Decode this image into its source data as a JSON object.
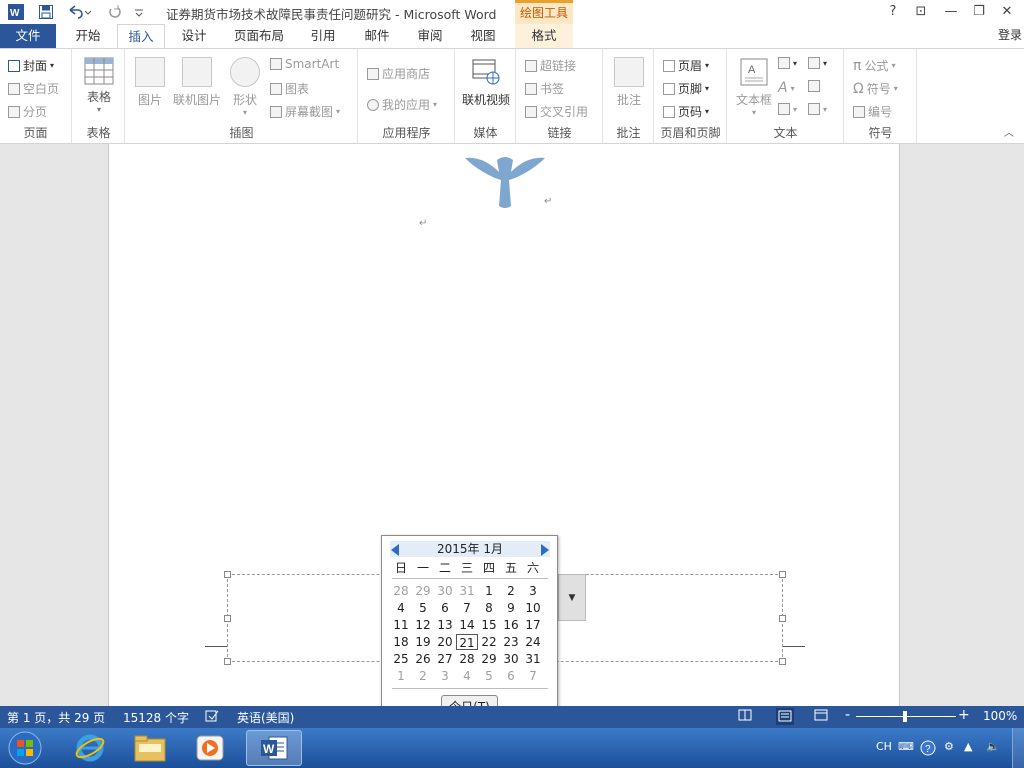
{
  "titlebar": {
    "title": "证券期货市场技术故障民事责任问题研究 - Microsoft Word",
    "context_tool": "绘图工具",
    "help": "?",
    "restore_ribbon": "⊡",
    "minimize": "—",
    "restore": "❐",
    "close": "✕"
  },
  "tabs": {
    "file": "文件",
    "home": "开始",
    "insert": "插入",
    "design": "设计",
    "layout": "页面布局",
    "references": "引用",
    "mailings": "邮件",
    "review": "审阅",
    "view": "视图",
    "format": "格式",
    "login": "登录"
  },
  "ribbon": {
    "pages": {
      "label": "页面",
      "cover": "封面",
      "blank": "空白页",
      "break": "分页"
    },
    "tables": {
      "label": "表格",
      "table": "表格"
    },
    "illustrations": {
      "label": "插图",
      "picture": "图片",
      "online_picture": "联机图片",
      "shapes": "形状",
      "smartart": "SmartArt",
      "chart": "图表",
      "screenshot": "屏幕截图"
    },
    "apps": {
      "label": "应用程序",
      "store": "应用商店",
      "my_apps": "我的应用"
    },
    "media": {
      "label": "媒体",
      "online_video": "联机视频"
    },
    "links": {
      "label": "链接",
      "hyperlink": "超链接",
      "bookmark": "书签",
      "cross_ref": "交叉引用"
    },
    "comments": {
      "label": "批注",
      "comment": "批注"
    },
    "header_footer": {
      "label": "页眉和页脚",
      "header": "页眉",
      "footer": "页脚",
      "page_number": "页码"
    },
    "text": {
      "label": "文本",
      "textbox": "文本框"
    },
    "symbols": {
      "label": "符号",
      "equation": "公式",
      "symbol": "符号",
      "number": "编号"
    }
  },
  "document": {
    "para_mark": "↵"
  },
  "calendar": {
    "month_label": "2015年 1月",
    "weekdays": [
      "日",
      "一",
      "二",
      "三",
      "四",
      "五",
      "六"
    ],
    "weeks": [
      [
        "28",
        "29",
        "30",
        "31",
        "1",
        "2",
        "3"
      ],
      [
        "4",
        "5",
        "6",
        "7",
        "8",
        "9",
        "10"
      ],
      [
        "11",
        "12",
        "13",
        "14",
        "15",
        "16",
        "17"
      ],
      [
        "18",
        "19",
        "20",
        "21",
        "22",
        "23",
        "24"
      ],
      [
        "25",
        "26",
        "27",
        "28",
        "29",
        "30",
        "31"
      ],
      [
        "1",
        "2",
        "3",
        "4",
        "5",
        "6",
        "7"
      ]
    ],
    "today_button": "今日(T)"
  },
  "statusbar": {
    "page": "第 1 页，共 29 页",
    "words": "15128 个字",
    "language": "英语(美国)",
    "zoom": "100%",
    "zoom_minus": "-",
    "zoom_plus": "+"
  },
  "taskbar": {
    "ime": "CH"
  },
  "colors": {
    "accent": "#2b579a",
    "context_tab": "#e8a030",
    "logo": "#7fa6cf"
  }
}
